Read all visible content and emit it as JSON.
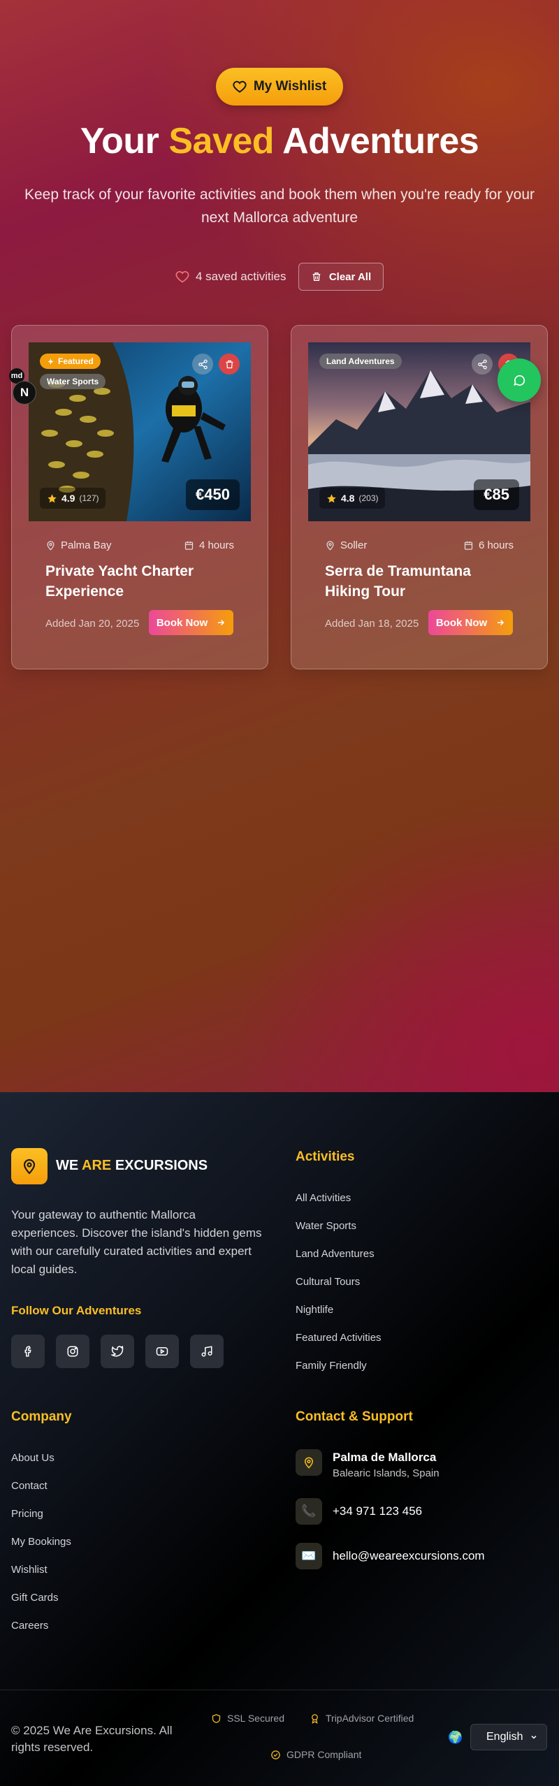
{
  "hero": {
    "pill_label": "My Wishlist",
    "title_part1": "Your",
    "title_accent": "Saved",
    "title_part2": "Adventures",
    "subtitle": "Keep track of your favorite activities and book them when you're ready for your next Mallorca adventure",
    "saved_count": "4 saved activities",
    "clear_label": "Clear All"
  },
  "cards": [
    {
      "featured_label": "Featured",
      "category": "Water Sports",
      "rating": "4.9",
      "reviews": "(127)",
      "price": "€450",
      "location": "Palma Bay",
      "duration": "4 hours",
      "title": "Private Yacht Charter Experience",
      "added": "Added Jan 20, 2025",
      "book_label": "Book Now"
    },
    {
      "category": "Land Adventures",
      "rating": "4.8",
      "reviews": "(203)",
      "price": "€85",
      "location": "Soller",
      "duration": "6 hours",
      "title": "Serra de Tramuntana Hiking Tour",
      "added": "Added Jan 18, 2025",
      "book_label": "Book Now"
    }
  ],
  "overlay": {
    "md": "md",
    "n": "N"
  },
  "footer": {
    "brand_we": "WE",
    "brand_are": "ARE",
    "brand_excursions": "EXCURSIONS",
    "description": "Your gateway to authentic Mallorca experiences. Discover the island's hidden gems with our carefully curated activities and expert local guides.",
    "follow_heading": "Follow Our Adventures",
    "activities_heading": "Activities",
    "activities": [
      "All Activities",
      "Water Sports",
      "Land Adventures",
      "Cultural Tours",
      "Nightlife",
      "Featured Activities",
      "Family Friendly"
    ],
    "company_heading": "Company",
    "company": [
      "About Us",
      "Contact",
      "Pricing",
      "My Bookings",
      "Wishlist",
      "Gift Cards",
      "Careers"
    ],
    "contact_heading": "Contact & Support",
    "address_title": "Palma de Mallorca",
    "address_sub": "Balearic Islands, Spain",
    "phone": "+34 971 123 456",
    "email": "hello@weareexcursions.com",
    "copyright": "© 2025 We Are Excursions. All rights reserved.",
    "trust_ssl": "SSL Secured",
    "trust_tripadvisor": "TripAdvisor Certified",
    "trust_gdpr": "GDPR Compliant",
    "language": "English"
  },
  "colors": {
    "accent": "#fbbf24",
    "danger": "#dc4545",
    "whatsapp": "#22c55e",
    "book_gradient_start": "#ec4899",
    "book_gradient_end": "#f59e0b"
  }
}
